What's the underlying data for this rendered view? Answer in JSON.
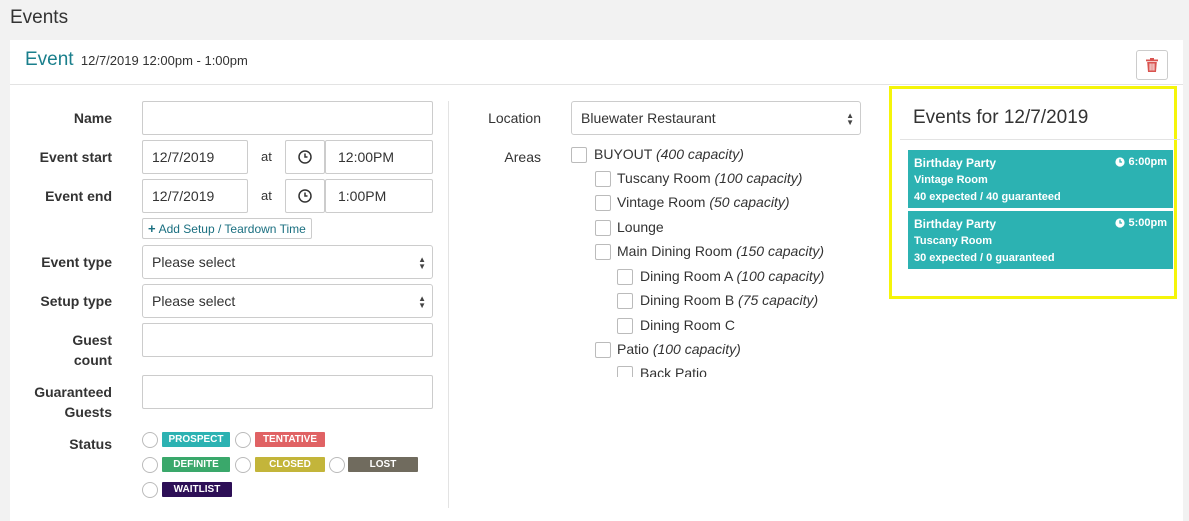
{
  "page": {
    "title": "Events"
  },
  "header": {
    "title": "Event",
    "datetime": "12/7/2019 12:00pm - 1:00pm"
  },
  "form": {
    "name_label": "Name",
    "name_value": "",
    "start_label": "Event start",
    "start_date": "12/7/2019",
    "at": "at",
    "start_time": "12:00PM",
    "end_label": "Event end",
    "end_date": "12/7/2019",
    "end_time": "1:00PM",
    "add_setup_label": "Add Setup / Teardown Time",
    "event_type_label": "Event type",
    "event_type_value": "Please select",
    "setup_type_label": "Setup type",
    "setup_type_value": "Please select",
    "guest_count_label_1": "Guest",
    "guest_count_label_2": "count",
    "guaranteed_label_1": "Guaranteed",
    "guaranteed_label_2": "Guests",
    "status_label": "Status",
    "statuses": [
      {
        "label": "PROSPECT",
        "color": "#2cb2b2"
      },
      {
        "label": "TENTATIVE",
        "color": "#e06264"
      },
      {
        "label": "DEFINITE",
        "color": "#3aa86b"
      },
      {
        "label": "CLOSED",
        "color": "#c3b53a"
      },
      {
        "label": "LOST",
        "color": "#706b5e"
      },
      {
        "label": "WAITLIST",
        "color": "#2d0f56"
      }
    ]
  },
  "location": {
    "label": "Location",
    "value": "Bluewater Restaurant",
    "areas_label": "Areas",
    "areas": [
      {
        "name": "BUYOUT",
        "cap": "(400 capacity)"
      },
      {
        "name": "Tuscany Room",
        "cap": "(100 capacity)"
      },
      {
        "name": "Vintage Room",
        "cap": "(50 capacity)"
      },
      {
        "name": "Lounge",
        "cap": ""
      },
      {
        "name": "Main Dining Room",
        "cap": "(150 capacity)"
      },
      {
        "name": "Dining Room A",
        "cap": "(100 capacity)"
      },
      {
        "name": "Dining Room B",
        "cap": "(75 capacity)"
      },
      {
        "name": "Dining Room C",
        "cap": ""
      },
      {
        "name": "Patio",
        "cap": "(100 capacity)"
      },
      {
        "name": "Back Patio",
        "cap": ""
      }
    ]
  },
  "sidebar": {
    "title": "Events for 12/7/2019",
    "events": [
      {
        "name": "Birthday Party",
        "time": "6:00pm",
        "room": "Vintage Room",
        "counts": "40 expected / 40 guaranteed"
      },
      {
        "name": "Birthday Party",
        "time": "5:00pm",
        "room": "Tuscany Room",
        "counts": "30 expected / 0 guaranteed"
      }
    ]
  },
  "colors": {
    "accent": "#1a7f8c",
    "event_block": "#2cb2b2",
    "highlight": "#f5f50a",
    "delete": "#d9534f"
  }
}
